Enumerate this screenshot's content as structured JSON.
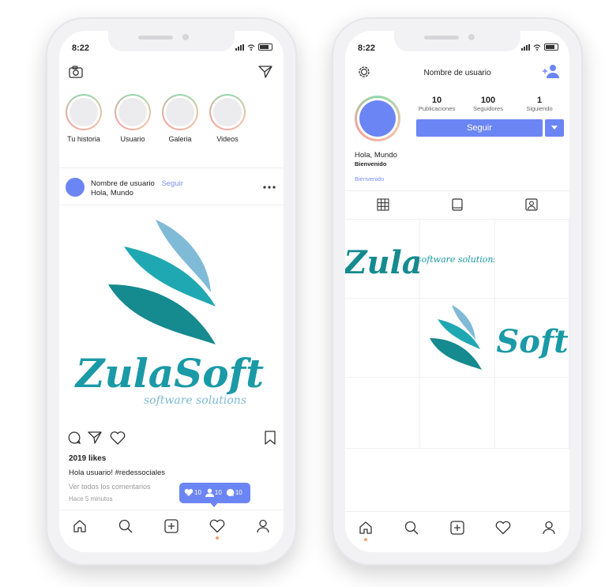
{
  "status": {
    "time": "8:22"
  },
  "feed": {
    "stories": [
      {
        "label": "Tu historia"
      },
      {
        "label": "Usuario"
      },
      {
        "label": "Galeria"
      },
      {
        "label": "Videos"
      }
    ],
    "post": {
      "username": "Nombre de usuario",
      "follow": "Seguir",
      "subtitle": "Hola, Mundo",
      "likes": "2019 likes",
      "caption": "Hola usuario! #redessociales",
      "comments_link": "Ver todos los comentarios",
      "time_ago": "Hace 5 minutos"
    },
    "logo": {
      "word1": "Zula",
      "word2": "Soft",
      "tagline": "software solutions"
    },
    "notification": {
      "likes": "10",
      "followers": "10",
      "comments": "10"
    }
  },
  "profile": {
    "title": "Nombre de usuario",
    "stats": [
      {
        "value": "10",
        "label": "Publicaciones"
      },
      {
        "value": "100",
        "label": "Seguidores"
      },
      {
        "value": "1",
        "label": "Siguiendo"
      }
    ],
    "follow_button": "Seguir",
    "name": "Hola, Mundo",
    "bio": "Bienvenido",
    "link": "Bienvenido",
    "grid": {
      "zula": "Zula",
      "tagline": "software solutions",
      "soft": "Soft"
    }
  },
  "colors": {
    "accent": "#6c85f5",
    "teal": "#1a9aa6",
    "light_teal": "#7fbad6",
    "dark_teal": "#158a8f"
  },
  "icons": [
    "camera-icon",
    "send-icon",
    "more-icon",
    "comment-icon",
    "heart-icon",
    "bookmark-icon",
    "home-icon",
    "search-icon",
    "add-icon",
    "user-icon",
    "settings-icon",
    "add-user-icon",
    "grid-icon",
    "tablet-icon",
    "tagged-icon",
    "chevron-down-icon"
  ]
}
